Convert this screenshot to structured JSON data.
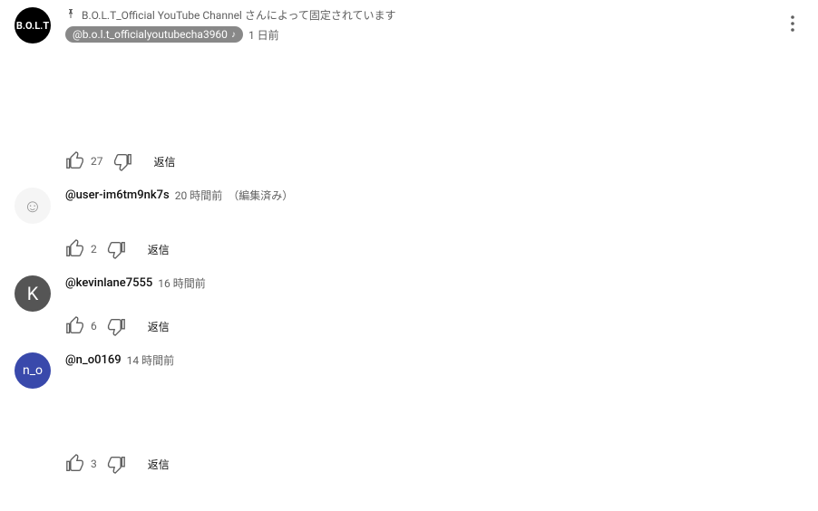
{
  "pinned": {
    "label": "B.O.L.T_Official YouTube Channel さんによって固定されています",
    "chip": "@b.o.l.t_officialyoutubecha3960",
    "time": "1 日前",
    "avatar_text": "B.O.L.T",
    "likes": "27",
    "reply": "返信"
  },
  "comments": [
    {
      "author": "@user-im6tm9nk7s",
      "time": "20 時間前",
      "edited": "（編集済み）",
      "avatar_class": "sketch",
      "avatar_text": "☺",
      "likes": "2",
      "reply": "返信"
    },
    {
      "author": "@kevinlane7555",
      "time": "16 時間前",
      "edited": "",
      "avatar_class": "k",
      "avatar_text": "K",
      "likes": "6",
      "reply": "返信"
    },
    {
      "author": "@n_o0169",
      "time": "14 時間前",
      "edited": "",
      "avatar_class": "no",
      "avatar_text": "n_o",
      "likes": "3",
      "reply": "返信"
    }
  ]
}
